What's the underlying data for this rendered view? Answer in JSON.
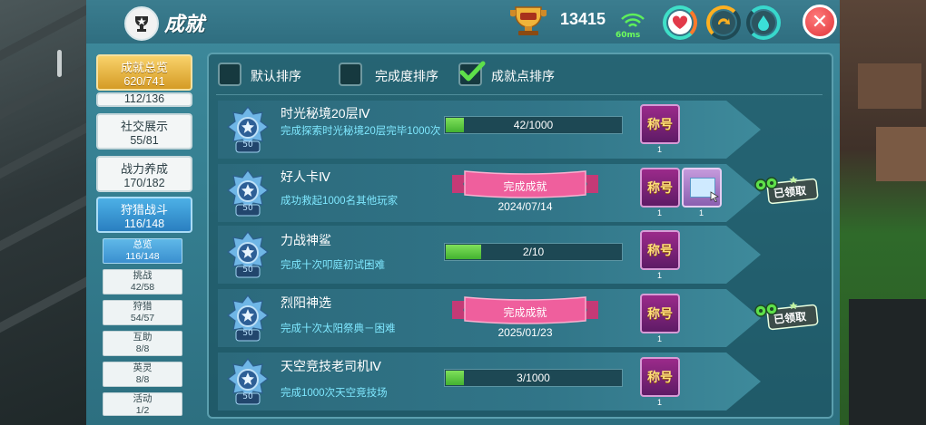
{
  "header": {
    "title": "成就",
    "trophy_points": "13415",
    "ping": "60ms"
  },
  "nav": {
    "overview": {
      "label": "成就总览",
      "count": "620/741"
    },
    "cut_off_count": "112/136",
    "categories": [
      {
        "label": "社交展示",
        "count": "55/81"
      },
      {
        "label": "战力养成",
        "count": "170/182"
      },
      {
        "label": "狩猎战斗",
        "count": "116/148"
      }
    ],
    "subcategories": [
      {
        "label": "总览",
        "count": "116/148"
      },
      {
        "label": "挑战",
        "count": "42/58"
      },
      {
        "label": "狩猎",
        "count": "54/57"
      },
      {
        "label": "互助",
        "count": "8/8"
      },
      {
        "label": "英灵",
        "count": "8/8"
      },
      {
        "label": "活动",
        "count": "1/2"
      }
    ]
  },
  "sort": {
    "default_label": "默认排序",
    "completion_label": "完成度排序",
    "points_label": "成就点排序",
    "selected": "成就点排序"
  },
  "achievements": [
    {
      "name": "时光秘境20层Ⅳ",
      "badge_points": "50",
      "desc": "完成探索时光秘境20层完毕1000次",
      "progress_text": "42/1000",
      "progress": 0.042,
      "reward_label": "称号",
      "reward_qty": "1"
    },
    {
      "name": "好人卡Ⅳ",
      "badge_points": "50",
      "desc": "成功救起1000名其他玩家",
      "complete_label": "完成成就",
      "date": "2024/07/14",
      "reward_label": "称号",
      "reward_qty": "1",
      "extra_qty": "1",
      "claimed_label": "已领取"
    },
    {
      "name": "力战神鲨",
      "badge_points": "50",
      "desc": "完成十次叩庭初试困难",
      "progress_text": "2/10",
      "progress": 0.2,
      "reward_label": "称号",
      "reward_qty": "1"
    },
    {
      "name": "烈阳神选",
      "badge_points": "50",
      "desc": "完成十次太阳祭典－困难",
      "complete_label": "完成成就",
      "date": "2025/01/23",
      "reward_label": "称号",
      "reward_qty": "1",
      "claimed_label": "已领取"
    },
    {
      "name": "天空竞技老司机Ⅳ",
      "badge_points": "50",
      "desc": "完成1000次天空竞技场",
      "progress_text": "3/1000",
      "progress": 0.003,
      "reward_label": "称号",
      "reward_qty": "1"
    }
  ]
}
